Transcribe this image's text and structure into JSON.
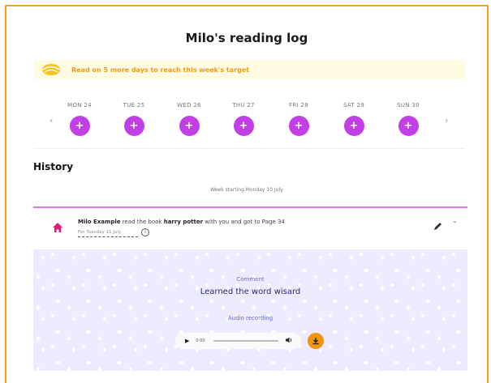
{
  "page": {
    "title": "Milo's reading log"
  },
  "banner": {
    "text": "Read on 5 more days to reach this week's target",
    "icon": "sun-icon"
  },
  "week": {
    "prev_icon": "‹",
    "next_icon": "›",
    "days": [
      {
        "label": "MON 24",
        "button": "+"
      },
      {
        "label": "TUE 25",
        "button": "+"
      },
      {
        "label": "WED 26",
        "button": "+"
      },
      {
        "label": "THU 27",
        "button": "+"
      },
      {
        "label": "FRI 28",
        "button": "+"
      },
      {
        "label": "SAT 29",
        "button": "+"
      },
      {
        "label": "SUN 30",
        "button": "+"
      }
    ]
  },
  "history": {
    "heading": "History",
    "week_starting": "Week starting Monday 10 July",
    "entry": {
      "reader": "Milo Example",
      "verb1": "read the book",
      "book": "harry potter",
      "verb2": "with you and got to Page 34",
      "date": "For Tuesday 11 July",
      "info_icon": "i",
      "chevron": "⌄",
      "comment_label": "Comment",
      "comment": "Learned the word wisard",
      "audio_label": "Audio recording",
      "audio_time": "0:00",
      "play_icon": "▶",
      "volume_icon": "🔊"
    }
  },
  "colors": {
    "accent_purple": "#c23fe6",
    "accent_orange": "#f4930c",
    "border_orange": "#f4a21d",
    "house_pink": "#e8197d"
  }
}
